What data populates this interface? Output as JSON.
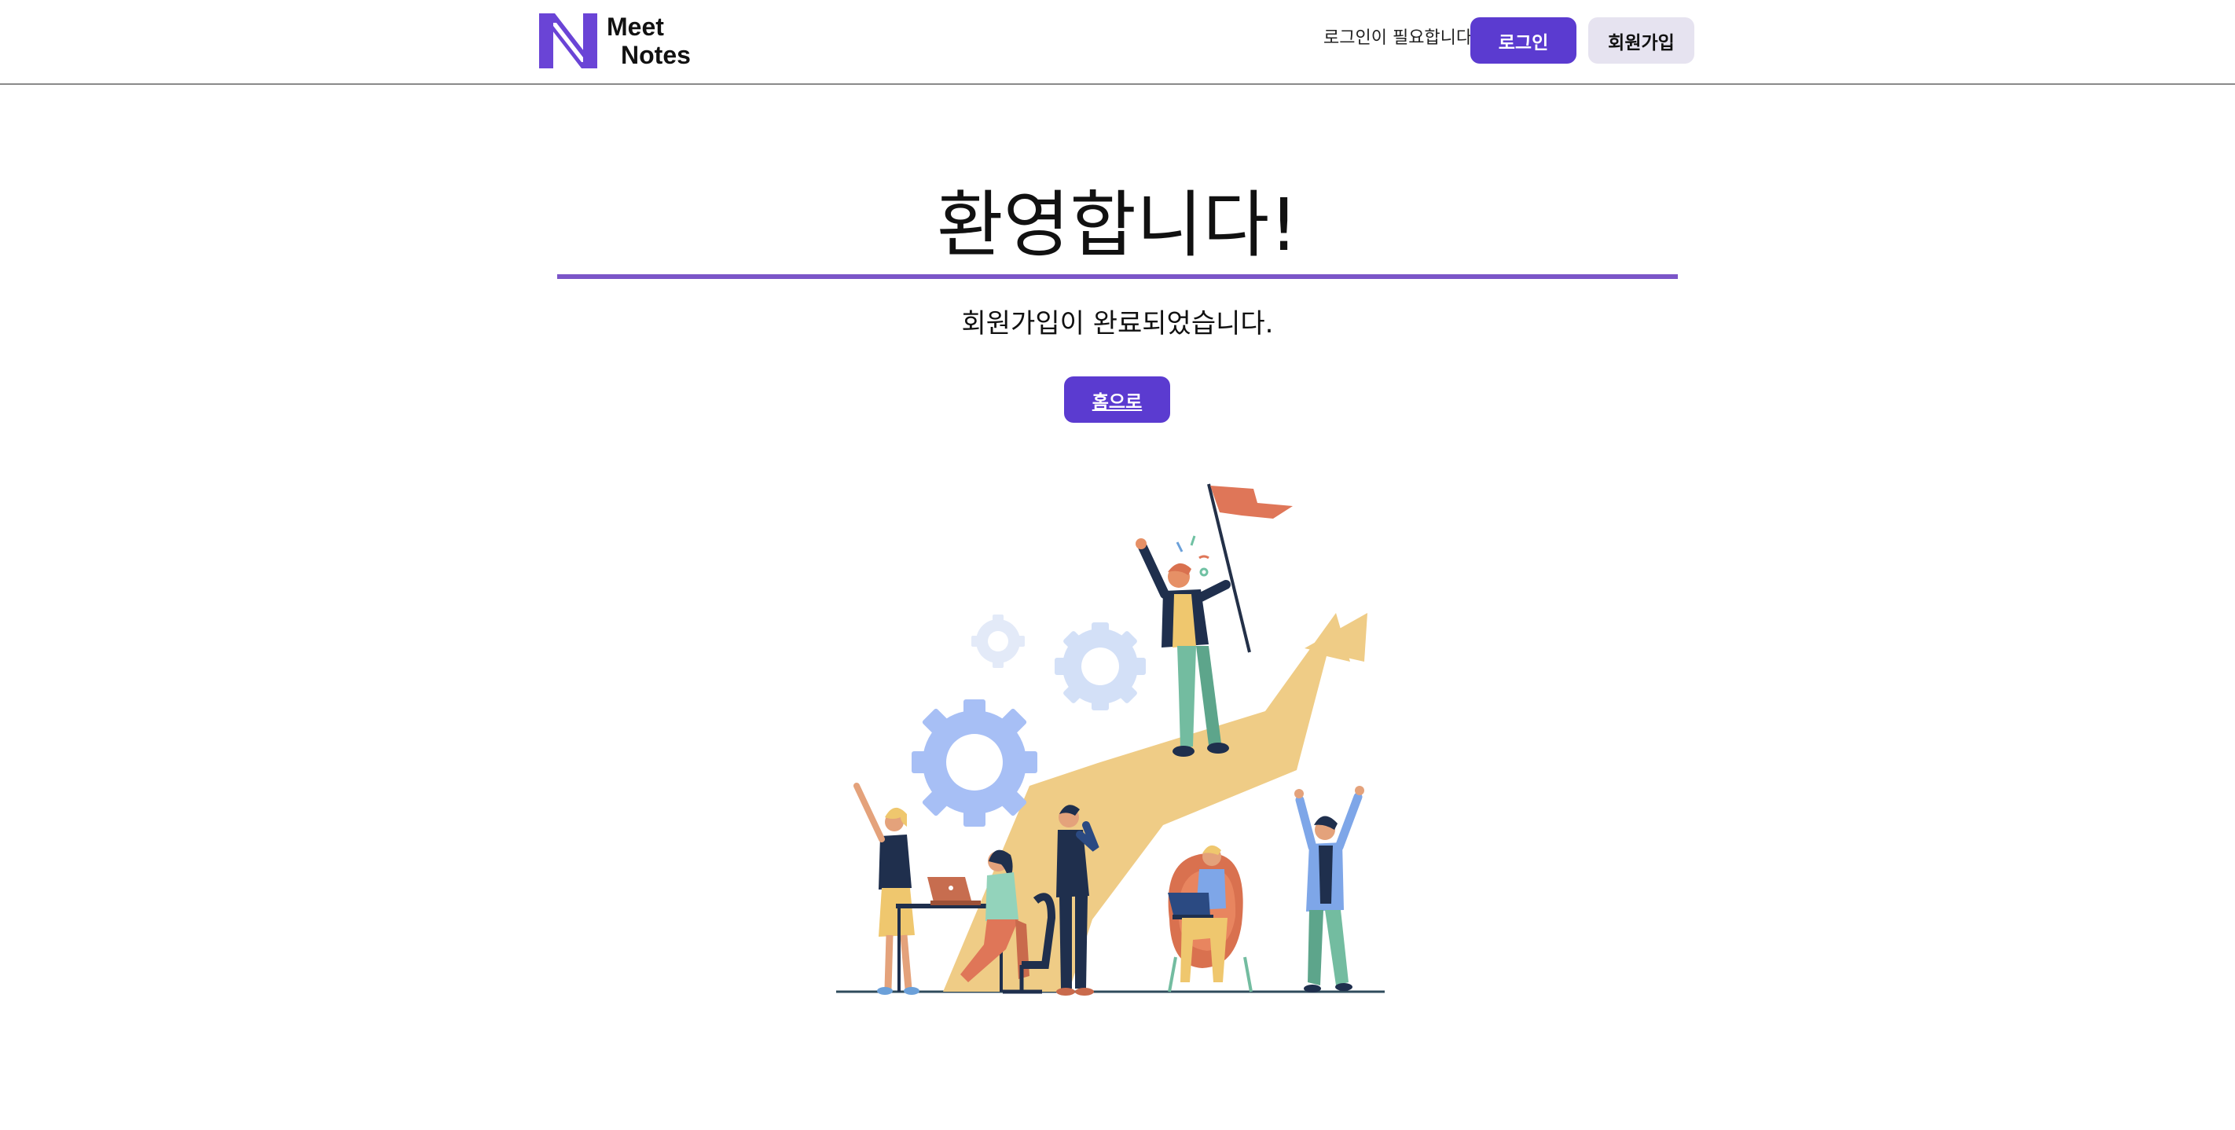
{
  "header": {
    "brand": {
      "line1": "Meet",
      "line2": "Notes",
      "logo_icon": "n-letter-logo",
      "logo_color": "#6a44d6"
    },
    "login_notice": "로그인이 필요합니다",
    "login_button": "로그인",
    "signup_button": "회원가입"
  },
  "main": {
    "title": "환영합니다!",
    "subtitle": "회원가입이 완료되었습니다.",
    "home_button": "홈으로",
    "illustration": "team-success-illustration"
  },
  "colors": {
    "accent": "#5b3bd0",
    "accent_rule": "#7b55c8",
    "secondary_button": "#e6e3f0"
  }
}
